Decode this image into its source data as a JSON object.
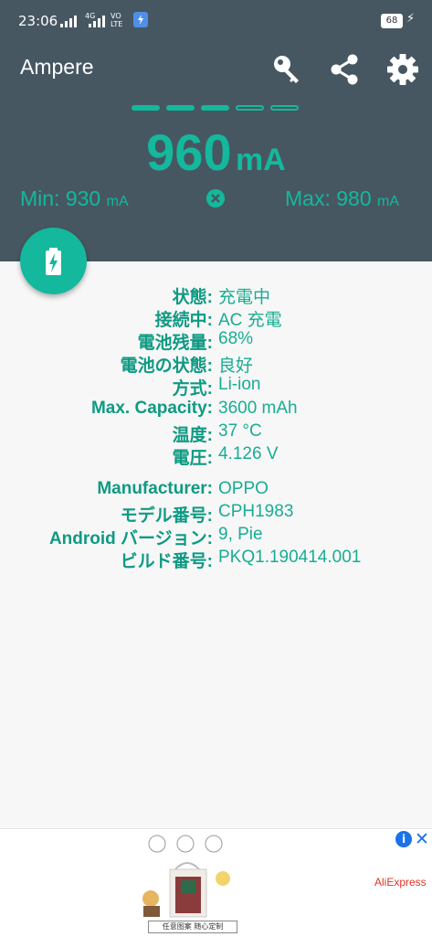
{
  "status_bar": {
    "time": "23:06",
    "network_label": "4G",
    "volte_label": "VO\nLTE",
    "battery_level": "68"
  },
  "app": {
    "title": "Ampere",
    "toolbar": {
      "key_icon": "key-icon",
      "share_icon": "share-icon",
      "settings_icon": "gear-icon"
    }
  },
  "meter": {
    "level_segments_total": 5,
    "level_segments_filled": 3,
    "current_value": "960",
    "current_unit": "mA",
    "min_label": "Min: 930",
    "min_unit": "mA",
    "max_label": "Max: 980",
    "max_unit": "mA",
    "reset_icon": "close-circle-icon"
  },
  "fab": {
    "icon": "battery-charging-icon"
  },
  "battery_info": [
    {
      "key": "状態:",
      "value": "充電中"
    },
    {
      "key": "接続中:",
      "value": "AC 充電"
    },
    {
      "key": "電池残量:",
      "value": "68%"
    },
    {
      "key": "電池の状態:",
      "value": "良好"
    },
    {
      "key": "方式:",
      "value": "Li-ion"
    },
    {
      "key": "Max. Capacity:",
      "value": "3600 mAh"
    },
    {
      "key": "温度:",
      "value": "37 °C"
    },
    {
      "key": "電圧:",
      "value": "4.126 V"
    }
  ],
  "device_info": [
    {
      "key": "Manufacturer:",
      "value": "OPPO"
    },
    {
      "key": "モデル番号:",
      "value": "CPH1983"
    },
    {
      "key": "Android バージョン:",
      "value": "9, Pie"
    },
    {
      "key": "ビルド番号:",
      "value": "PKQ1.190414.001"
    }
  ],
  "ad": {
    "caption": "任意图案 随心定制",
    "brand": "AliExpress",
    "info_icon": "info-icon",
    "close_icon": "close-icon"
  },
  "colors": {
    "header_bg": "#465762",
    "accent": "#14b89c",
    "body_bg": "#f7f7f7"
  }
}
